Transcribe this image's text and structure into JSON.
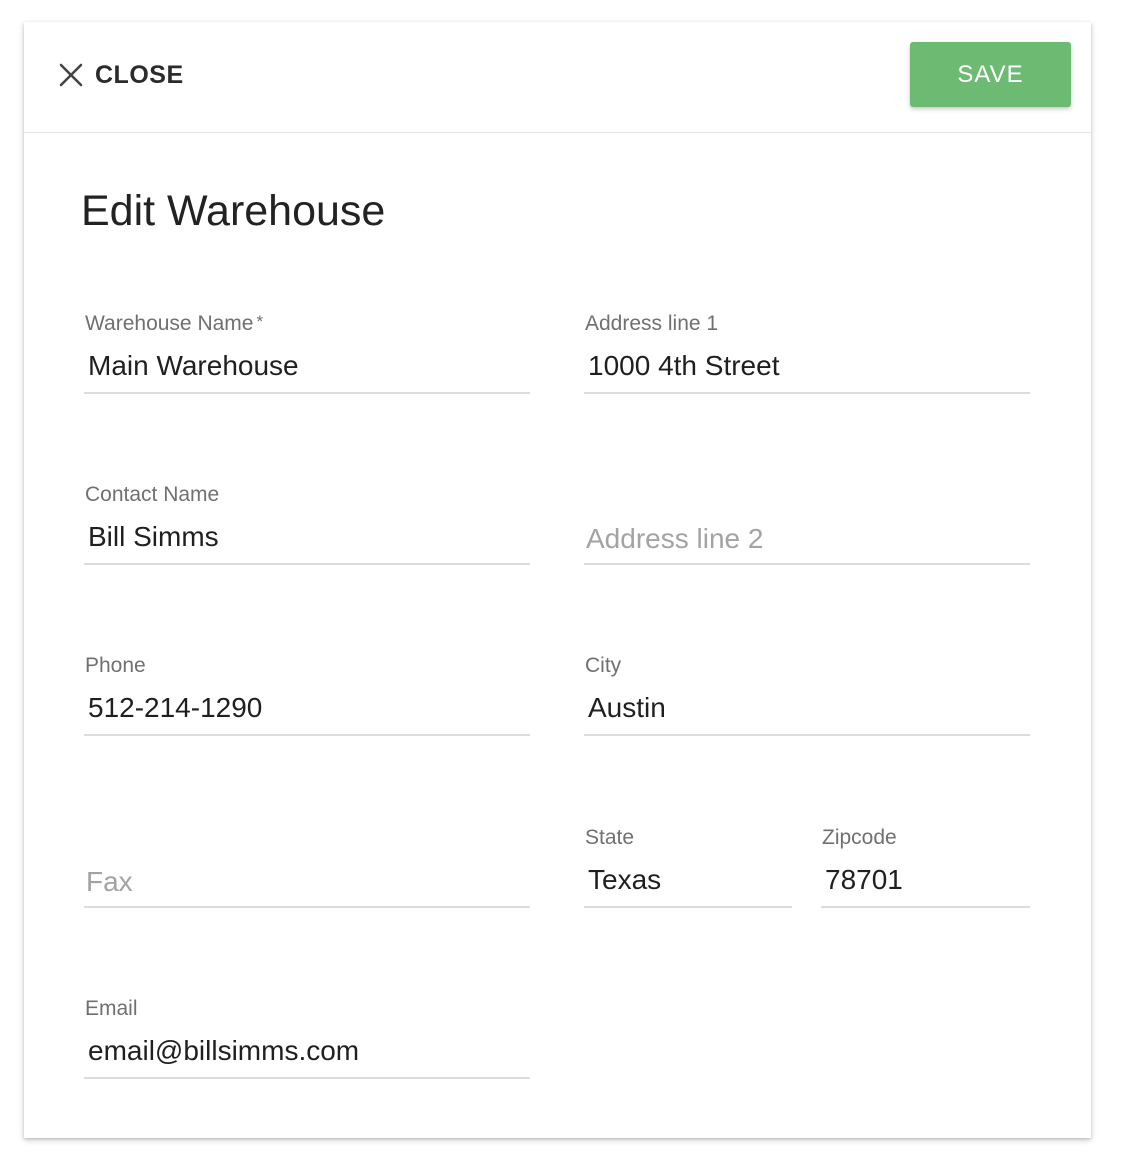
{
  "toolbar": {
    "close_label": "CLOSE",
    "close_icon": "close-icon",
    "save_label": "SAVE",
    "save_color": "#6dba72"
  },
  "title": "Edit Warehouse",
  "fields": {
    "warehouse_name": {
      "label": "Warehouse Name",
      "required_mark": "*",
      "value": "Main Warehouse"
    },
    "address_line_1": {
      "label": "Address line 1",
      "value": "1000 4th Street"
    },
    "contact_name": {
      "label": "Contact Name",
      "value": "Bill Simms"
    },
    "address_line_2": {
      "placeholder": "Address line 2",
      "value": ""
    },
    "phone": {
      "label": "Phone",
      "value": "512-214-1290"
    },
    "city": {
      "label": "City",
      "value": "Austin"
    },
    "fax": {
      "placeholder": "Fax",
      "value": ""
    },
    "state": {
      "label": "State",
      "value": "Texas"
    },
    "zipcode": {
      "label": "Zipcode",
      "value": "78701"
    },
    "email": {
      "label": "Email",
      "value": "email@billsimms.com"
    }
  }
}
